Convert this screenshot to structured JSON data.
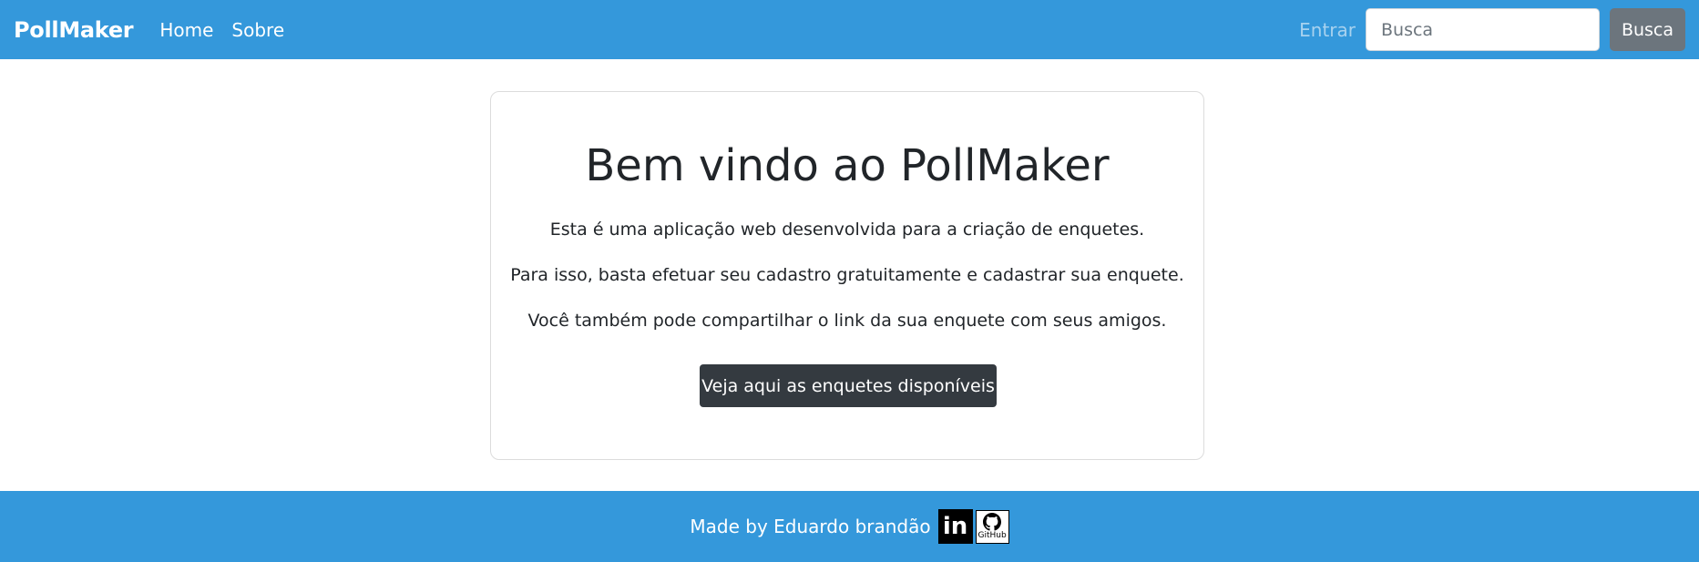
{
  "navbar": {
    "brand": "PollMaker",
    "links": [
      {
        "label": "Home"
      },
      {
        "label": "Sobre"
      }
    ],
    "login_label": "Entrar",
    "search": {
      "placeholder": "Busca",
      "value": "",
      "button_label": "Busca"
    }
  },
  "hero": {
    "title": "Bem vindo ao PollMaker",
    "paragraphs": [
      "Esta é uma aplicação web desenvolvida para a criação de enquetes.",
      "Para isso, basta efetuar seu cadastro gratuitamente e cadastrar sua enquete.",
      "Você também pode compartilhar o link da sua enquete com seus amigos."
    ],
    "cta_label": "Veja aqui as enquetes disponíveis"
  },
  "footer": {
    "text": "Made by Eduardo brandão",
    "linkedin_label": "in",
    "github_label": "GitHub"
  },
  "colors": {
    "primary": "#3498db",
    "secondary_button": "#6c757d",
    "dark_button": "#343a40"
  },
  "icons": {
    "linkedin": "linkedin-icon",
    "github": "github-icon"
  }
}
